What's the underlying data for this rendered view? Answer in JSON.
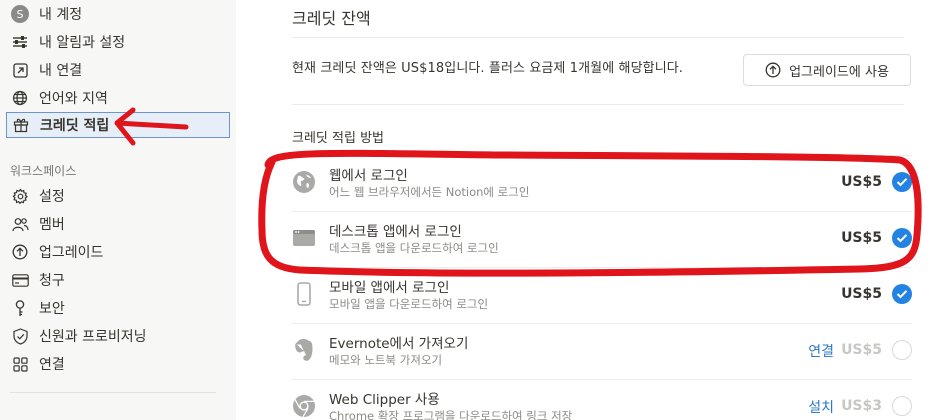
{
  "sidebar": {
    "account": [
      {
        "label": "내 계정",
        "icon": "avatar-icon",
        "avatar_letter": "S"
      },
      {
        "label": "내 알림과 설정",
        "icon": "sliders-icon"
      },
      {
        "label": "내 연결",
        "icon": "external-link-icon"
      },
      {
        "label": "언어와 지역",
        "icon": "globe-icon"
      },
      {
        "label": "크레딧 적립",
        "icon": "gift-icon",
        "active": true
      }
    ],
    "workspace_title": "워크스페이스",
    "workspace": [
      {
        "label": "설정",
        "icon": "gear-icon"
      },
      {
        "label": "멤버",
        "icon": "members-icon"
      },
      {
        "label": "업그레이드",
        "icon": "upgrade-icon"
      },
      {
        "label": "청구",
        "icon": "credit-card-icon"
      },
      {
        "label": "보안",
        "icon": "key-icon"
      },
      {
        "label": "신원과 프로비저닝",
        "icon": "shield-icon"
      },
      {
        "label": "연결",
        "icon": "grid-icon"
      }
    ]
  },
  "main": {
    "title": "크레딧 잔액",
    "balance_text": "현재 크레딧 잔액은 US$18입니다. 플러스 요금제 1개월에 해당합니다.",
    "upgrade_button": "업그레이드에 사용",
    "section_title": "크레딧 적립 방법",
    "rows": [
      {
        "title": "웹에서 로그인",
        "subtitle": "어느 웹 브라우저에서든 Notion에 로그인",
        "amount": "US$5",
        "checked": true,
        "icon": "globe-filled-icon"
      },
      {
        "title": "데스크톱 앱에서 로그인",
        "subtitle": "데스크톱 앱을 다운로드하여 로그인",
        "amount": "US$5",
        "checked": true,
        "icon": "desktop-icon"
      },
      {
        "title": "모바일 앱에서 로그인",
        "subtitle": "모바일 앱을 다운로드하여 로그인",
        "amount": "US$5",
        "checked": true,
        "icon": "mobile-icon"
      },
      {
        "title": "Evernote에서 가져오기",
        "subtitle": "메모와 노트북 가져오기",
        "amount": "US$5",
        "checked": false,
        "action": "연결",
        "icon": "evernote-icon"
      },
      {
        "title": "Web Clipper 사용",
        "subtitle": "Chrome 확장 프로그램을 다운로드하여 링크 저장",
        "amount": "US$3",
        "checked": false,
        "action": "설치",
        "icon": "chrome-icon"
      }
    ]
  },
  "annotation": {
    "color": "#e0141b"
  }
}
